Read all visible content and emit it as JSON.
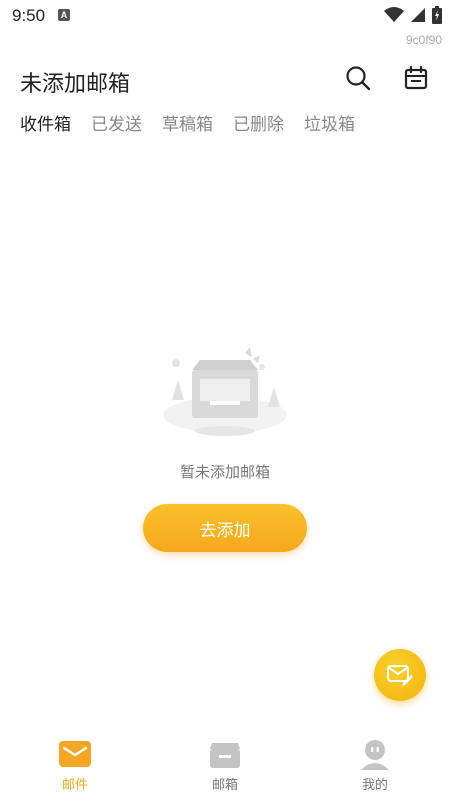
{
  "status_bar": {
    "time": "9:50",
    "badge": "A"
  },
  "build_tag": "9c0f90",
  "header": {
    "title": "未添加邮箱"
  },
  "tabs": [
    {
      "label": "收件箱",
      "active": true
    },
    {
      "label": "已发送",
      "active": false
    },
    {
      "label": "草稿箱",
      "active": false
    },
    {
      "label": "已删除",
      "active": false
    },
    {
      "label": "垃圾箱",
      "active": false
    }
  ],
  "empty_state": {
    "message": "暂未添加邮箱",
    "button_label": "去添加"
  },
  "bottom_nav": [
    {
      "label": "邮件",
      "icon": "mail-icon",
      "active": true
    },
    {
      "label": "邮箱",
      "icon": "mailbox-icon",
      "active": false
    },
    {
      "label": "我的",
      "icon": "profile-icon",
      "active": false
    }
  ],
  "colors": {
    "accent": "#f5a623",
    "accent_light": "#f9c12b"
  }
}
